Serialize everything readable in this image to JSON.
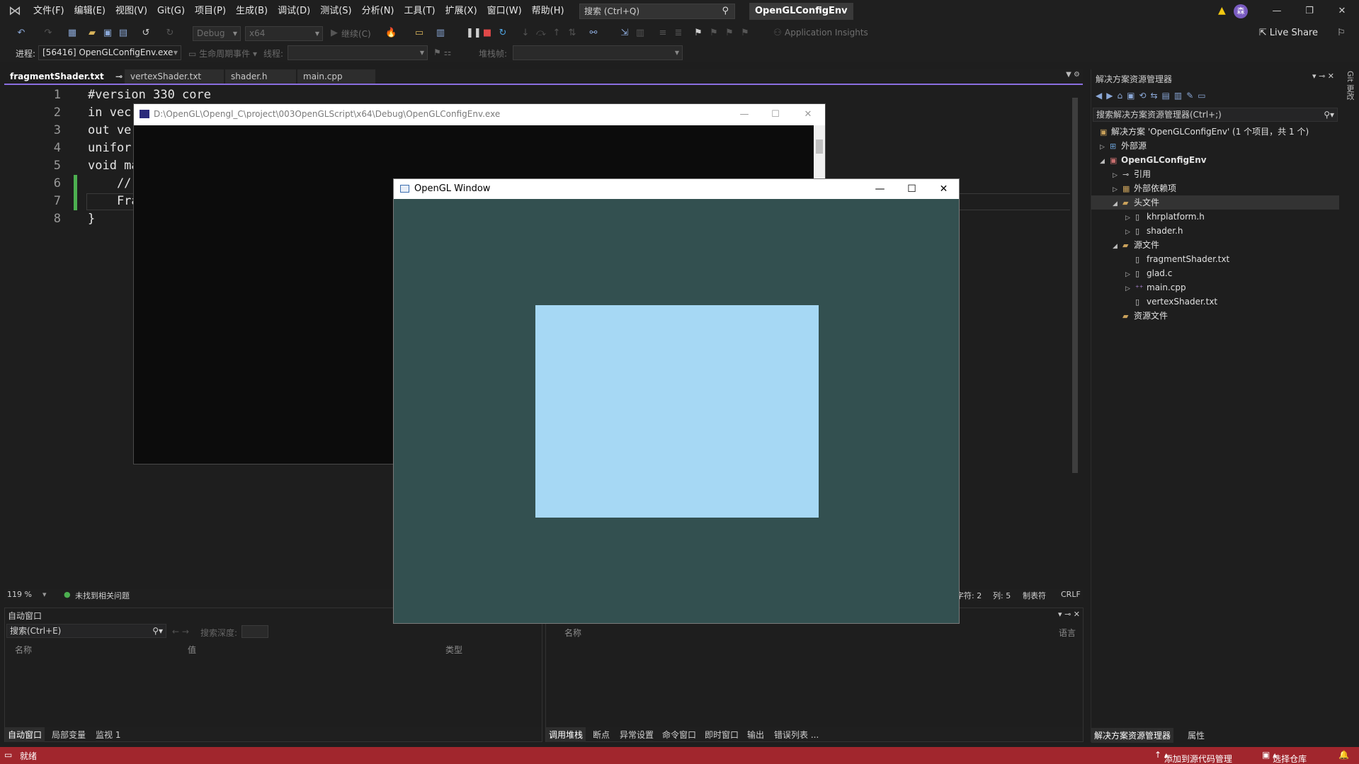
{
  "menubar": {
    "items": [
      "文件(F)",
      "编辑(E)",
      "视图(V)",
      "Git(G)",
      "项目(P)",
      "生成(B)",
      "调试(D)",
      "测试(S)",
      "分析(N)",
      "工具(T)",
      "扩展(X)",
      "窗口(W)",
      "帮助(H)"
    ],
    "search_placeholder": "搜索 (Ctrl+Q)",
    "solution_title": "OpenGLConfigEnv",
    "avatar_initial": "森"
  },
  "toolbar": {
    "config": "Debug",
    "platform": "x64",
    "continue": "继续(C)",
    "app_insights": "Application Insights",
    "live_share": "Live Share"
  },
  "debugbar": {
    "process_label": "进程:",
    "process_value": "[56416] OpenGLConfigEnv.exe",
    "lifecycle": "生命周期事件",
    "thread_label": "线程:",
    "stackframe_label": "堆栈帧:"
  },
  "tabs": [
    {
      "label": "fragmentShader.txt",
      "active": true
    },
    {
      "label": "vertexShader.txt",
      "active": false
    },
    {
      "label": "shader.h",
      "active": false
    },
    {
      "label": "main.cpp",
      "active": false
    }
  ],
  "code": {
    "line_numbers": [
      "1",
      "2",
      "3",
      "4",
      "5",
      "6",
      "7",
      "8"
    ],
    "lines": [
      "#version 330 core",
      "in vec",
      "out ve",
      "unifor",
      "void ma",
      "    //",
      "    Fra",
      "}"
    ]
  },
  "editor_status": {
    "zoom": "119 %",
    "issues": "未找到相关问题",
    "char": "字符: 2",
    "col": "列: 5",
    "tabs": "制表符",
    "eol": "CRLF"
  },
  "auto_window": {
    "title": "自动窗口",
    "search_placeholder": "搜索(Ctrl+E)",
    "search_depth": "搜索深度:",
    "col_name": "名称",
    "col_value": "值",
    "col_type": "类型",
    "tabs": [
      "自动窗口",
      "局部变量",
      "监视 1"
    ]
  },
  "callstack_window": {
    "col_name": "名称",
    "col_lang": "语言",
    "tabs": [
      "调用堆栈",
      "断点",
      "异常设置",
      "命令窗口",
      "即时窗口",
      "输出",
      "错误列表 ..."
    ]
  },
  "solution_explorer": {
    "title": "解决方案资源管理器",
    "search_placeholder": "搜索解决方案资源管理器(Ctrl+;)",
    "items": [
      {
        "label": "解决方案 'OpenGLConfigEnv' (1 个项目，共 1 个)",
        "icon": "solution-icon"
      },
      {
        "label": "外部源",
        "icon": "external-sources-icon"
      },
      {
        "label": "OpenGLConfigEnv",
        "icon": "project-icon"
      },
      {
        "label": "引用",
        "icon": "references-icon"
      },
      {
        "label": "外部依赖项",
        "icon": "dependencies-icon"
      },
      {
        "label": "头文件",
        "icon": "folder-icon"
      },
      {
        "label": "khrplatform.h",
        "icon": "file-icon"
      },
      {
        "label": "shader.h",
        "icon": "file-icon"
      },
      {
        "label": "源文件",
        "icon": "folder-icon"
      },
      {
        "label": "fragmentShader.txt",
        "icon": "file-icon"
      },
      {
        "label": "glad.c",
        "icon": "file-icon"
      },
      {
        "label": "main.cpp",
        "icon": "cpp-file-icon"
      },
      {
        "label": "vertexShader.txt",
        "icon": "file-icon"
      },
      {
        "label": "资源文件",
        "icon": "folder-icon"
      }
    ],
    "footer_tabs": [
      "解决方案资源管理器",
      "属性"
    ],
    "side_tab": "Git 更改"
  },
  "console_window": {
    "title": "D:\\OpenGL\\Opengl_C\\project\\003OpenGLScript\\x64\\Debug\\OpenGLConfigEnv.exe"
  },
  "gl_window": {
    "title": "OpenGL Window",
    "clear_color": "#335050",
    "quad_color": "#a6d8f4"
  },
  "statusbar": {
    "ready": "就绪",
    "add_source_control": "添加到源代码管理",
    "select_repo": "选择仓库",
    "color": "#a1262d"
  }
}
